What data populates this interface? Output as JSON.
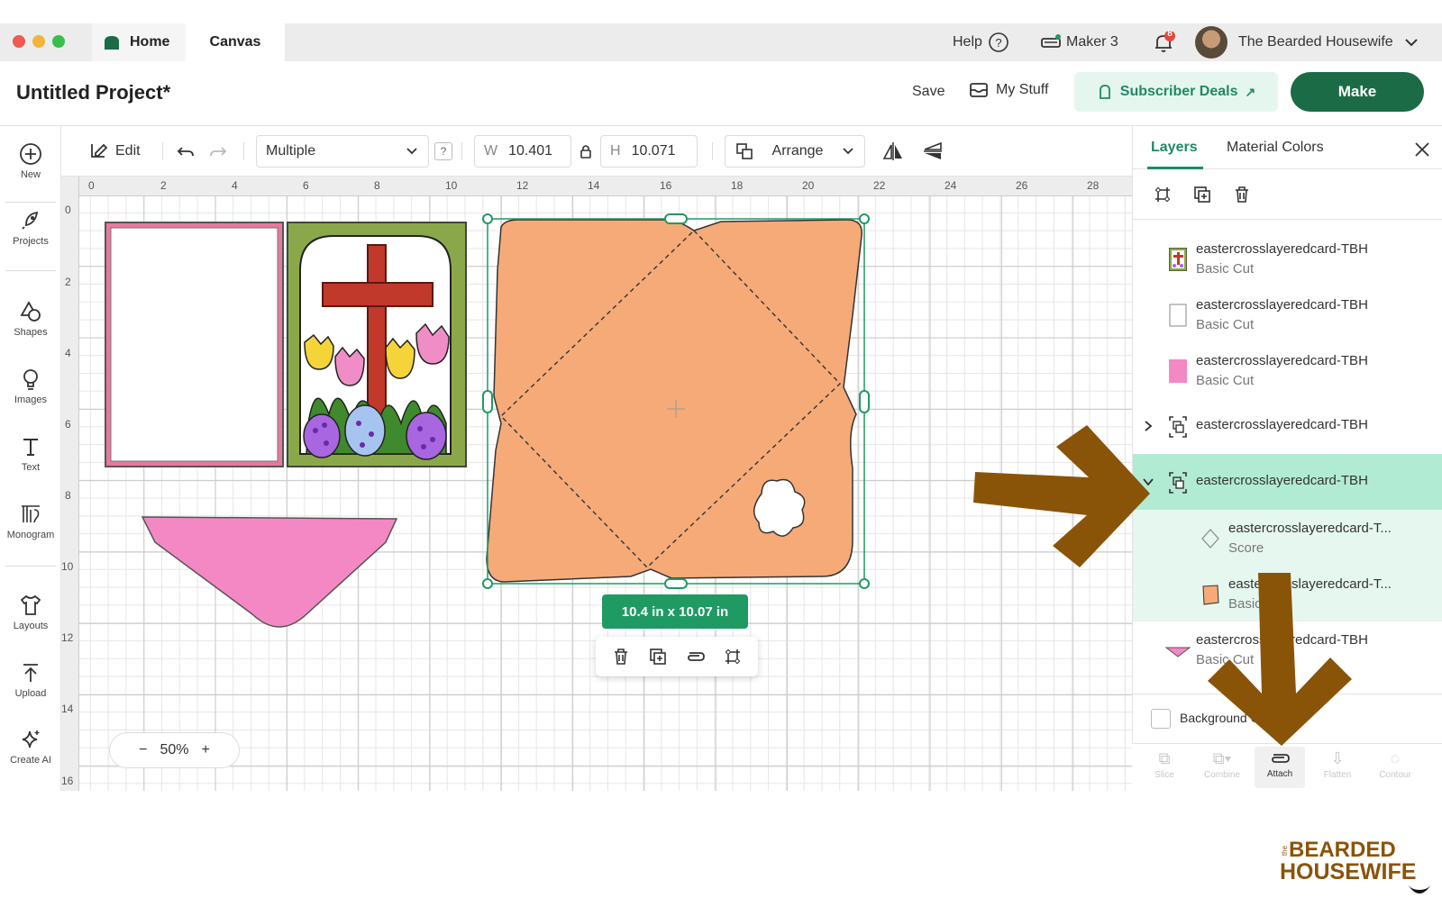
{
  "titlebar": {
    "tab_home": "Home",
    "tab_canvas": "Canvas",
    "help": "Help",
    "machine": "Maker 3",
    "notifications_count": "8",
    "user_name": "The Bearded Housewife"
  },
  "header": {
    "project_title": "Untitled Project*",
    "save": "Save",
    "my_stuff": "My Stuff",
    "subscriber_deals": "Subscriber Deals",
    "make": "Make"
  },
  "sidebar": {
    "items": [
      {
        "label": "New",
        "icon": "plus-circle-icon"
      },
      {
        "label": "Projects",
        "icon": "rocket-icon"
      },
      {
        "label": "Shapes",
        "icon": "shapes-icon"
      },
      {
        "label": "Images",
        "icon": "lightbulb-icon"
      },
      {
        "label": "Text",
        "icon": "text-icon"
      },
      {
        "label": "Monogram",
        "icon": "monogram-icon"
      },
      {
        "label": "Layouts",
        "icon": "tshirt-icon"
      },
      {
        "label": "Upload",
        "icon": "upload-icon"
      },
      {
        "label": "Create AI",
        "icon": "sparkle-icon"
      }
    ]
  },
  "toolbar": {
    "edit": "Edit",
    "operation": "Multiple",
    "help_q": "?",
    "w_label": "W",
    "w_value": "10.401",
    "h_label": "H",
    "h_value": "10.071",
    "arrange": "Arrange"
  },
  "ruler": {
    "top": [
      "0",
      "2",
      "4",
      "6",
      "8",
      "10",
      "12",
      "14",
      "16",
      "18",
      "20",
      "22",
      "24",
      "26",
      "28"
    ],
    "left": [
      "0",
      "2",
      "4",
      "6",
      "8",
      "10",
      "12",
      "14",
      "16"
    ]
  },
  "canvas": {
    "dimension_badge": "10.4  in x 10.07  in",
    "zoom": "50%",
    "zoom_minus": "−",
    "zoom_plus": "+"
  },
  "panel": {
    "tab_layers": "Layers",
    "tab_material": "Material Colors",
    "layers": [
      {
        "name": "eastercrosslayeredcard-TBH",
        "sub": "Basic Cut",
        "thumb": "card-thumb"
      },
      {
        "name": "eastercrosslayeredcard-TBH",
        "sub": "Basic Cut",
        "thumb": "white-rect"
      },
      {
        "name": "eastercrosslayeredcard-TBH",
        "sub": "Basic Cut",
        "thumb": "pink-rect"
      },
      {
        "name": "eastercrosslayeredcard-TBH",
        "sub": "",
        "thumb": "group"
      },
      {
        "name": "eastercrosslayeredcard-TBH",
        "sub": "",
        "thumb": "group"
      },
      {
        "name": "eastercrosslayeredcard-T...",
        "sub": "Score",
        "thumb": "score-diamond"
      },
      {
        "name": "eastercrosslayeredcard-T...",
        "sub": "Basic Cut",
        "thumb": "orange-shape"
      },
      {
        "name": "eastercrosslayeredcard-TBH",
        "sub": "Basic Cut",
        "thumb": "pink-triangle"
      }
    ],
    "background": "Background Color",
    "bottom_tools": [
      "Slice",
      "Combine",
      "Attach",
      "Flatten",
      "Contour"
    ]
  },
  "colors": {
    "accent": "#1f9a63",
    "make_button": "#1b6b47",
    "envelope": "#f5aa78",
    "pink": "#f388c4",
    "arrow": "#8a5408",
    "selected_row": "#b2ebd4"
  },
  "brand": {
    "line1": "BEARDED",
    "line2": "HOUSEWIFE",
    "small": "the"
  }
}
